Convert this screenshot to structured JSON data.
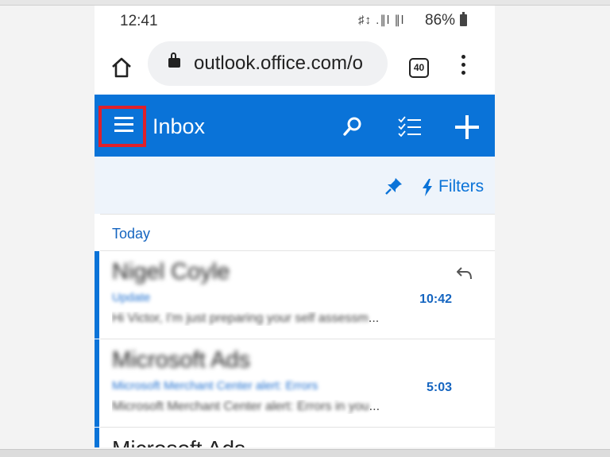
{
  "status_bar": {
    "time": "12:41",
    "signal_text": "♯↕ .∥l ∥l",
    "battery": "86%"
  },
  "browser": {
    "url": "outlook.office.com/o",
    "tab_count": "40"
  },
  "app_header": {
    "title": "Inbox",
    "accent_color": "#0a73d8",
    "highlight_color": "#e0202a"
  },
  "filter_bar": {
    "filters_label": "Filters"
  },
  "mail_list": {
    "group_label": "Today",
    "emails": [
      {
        "sender": "Nigel Coyle",
        "subject": "Update",
        "preview": "Hi Victor, I'm just preparing your self assessm",
        "time": "10:42",
        "replied": true
      },
      {
        "sender": "Microsoft Ads",
        "subject": "Microsoft Merchant Center alert: Errors",
        "preview": "Microsoft Merchant Center alert: Errors in you",
        "time": "5:03",
        "replied": false
      }
    ],
    "partial_next_sender": "Microsoft Ads"
  }
}
